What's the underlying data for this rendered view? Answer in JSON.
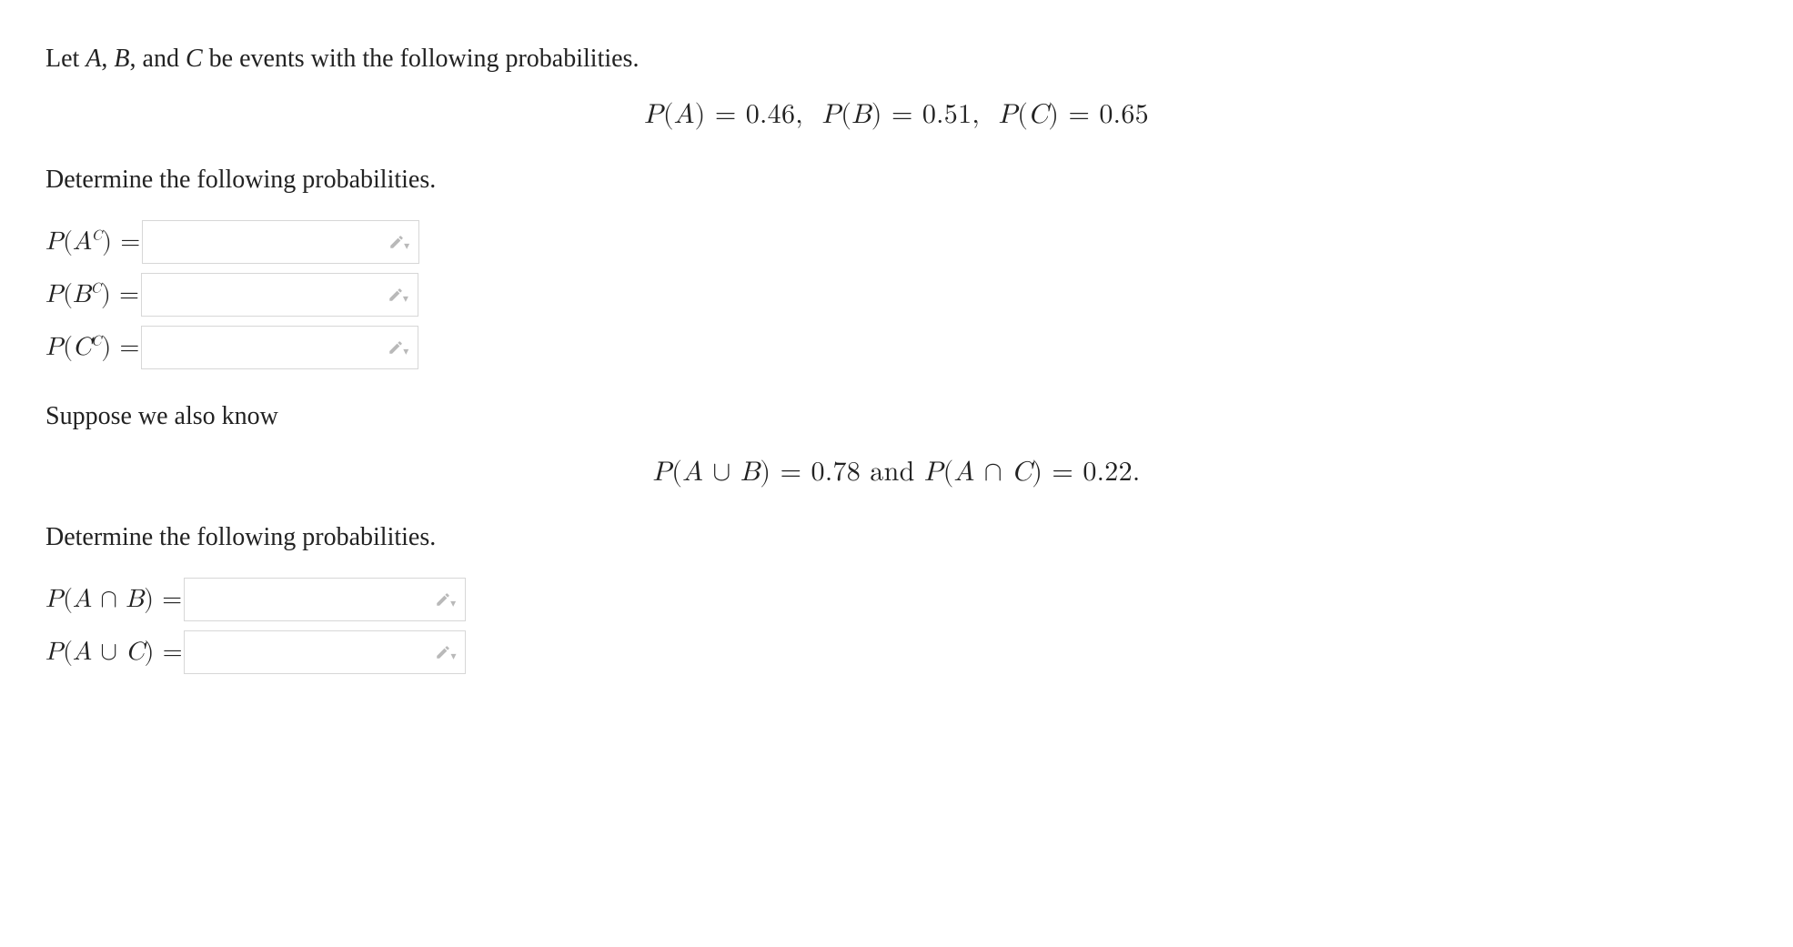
{
  "intro": "Let A, B, and C be events with the following probabilities.",
  "given_line": "P(A) = 0.46, P(B) = 0.51, P(C) = 0.65",
  "prompt1": "Determine the following probabilities.",
  "fields1": [
    {
      "label_html": "<span class='it'>P</span>(<span class='it'>A</span><span class='sup'>C</span>) =",
      "value": ""
    },
    {
      "label_html": "<span class='it'>P</span>(<span class='it'>B</span><span class='sup'>C</span>) =",
      "value": ""
    },
    {
      "label_html": "<span class='it'>P</span>(<span class='it'>C</span><span class='sup'>C</span>) =",
      "value": ""
    }
  ],
  "suppose": "Suppose we also know",
  "given_line2": "P(A ∪ B) = 0.78 and P(A ∩ C) = 0.22.",
  "prompt2": "Determine the following probabilities.",
  "fields2": [
    {
      "label_html": "<span class='it'>P</span>(<span class='it'>A</span> ∩ <span class='it'>B</span>) =",
      "value": ""
    },
    {
      "label_html": "<span class='it'>P</span>(<span class='it'>A</span> ∪ <span class='it'>C</span>) =",
      "value": ""
    }
  ],
  "given_values": {
    "P_A": 0.46,
    "P_B": 0.51,
    "P_C": 0.65,
    "P_A_union_B": 0.78,
    "P_A_inter_C": 0.22
  }
}
